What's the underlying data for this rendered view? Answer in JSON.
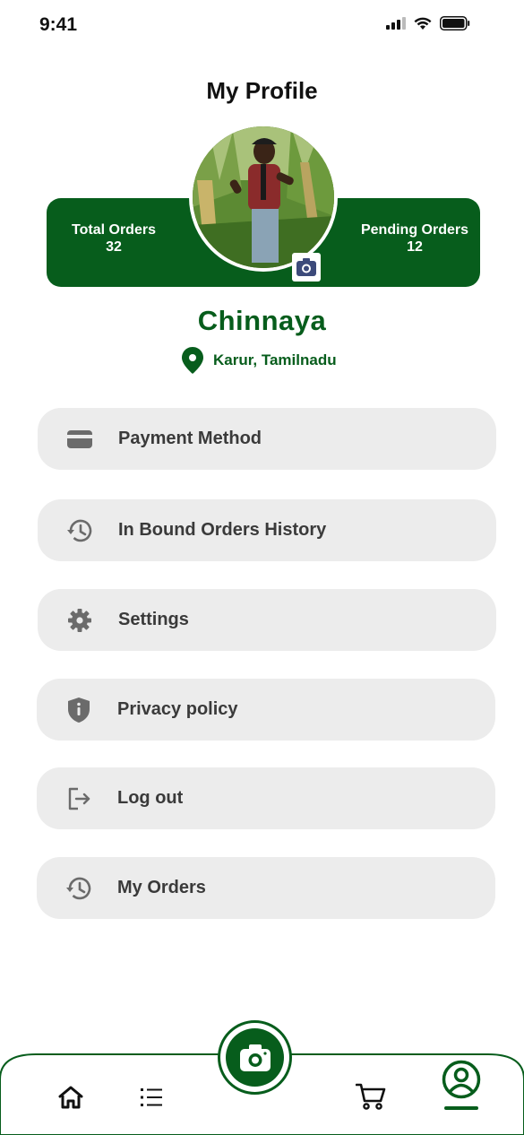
{
  "status_bar": {
    "time": "9:41"
  },
  "header": {
    "title": "My Profile"
  },
  "stats": {
    "total_label": "Total Orders",
    "total_value": "32",
    "pending_label": "Pending Orders",
    "pending_value": "12"
  },
  "profile": {
    "name": "Chinnaya",
    "location": "Karur, Tamilnadu"
  },
  "menu": [
    {
      "label": "Payment Method",
      "icon": "credit-card-icon"
    },
    {
      "label": "In Bound Orders History",
      "icon": "history-icon"
    },
    {
      "label": "Settings",
      "icon": "gear-icon"
    },
    {
      "label": "Privacy policy",
      "icon": "shield-info-icon"
    },
    {
      "label": "Log out",
      "icon": "logout-icon"
    },
    {
      "label": "My Orders",
      "icon": "history-icon"
    }
  ],
  "bottom_nav": {
    "items": [
      "home-icon",
      "list-icon",
      "camera-icon",
      "cart-icon",
      "profile-icon"
    ],
    "active": "profile-icon"
  },
  "colors": {
    "brand_green": "#075d1c",
    "menu_bg": "#ececec",
    "menu_text": "#3a3a3a",
    "icon_gray": "#6b6b6b"
  }
}
